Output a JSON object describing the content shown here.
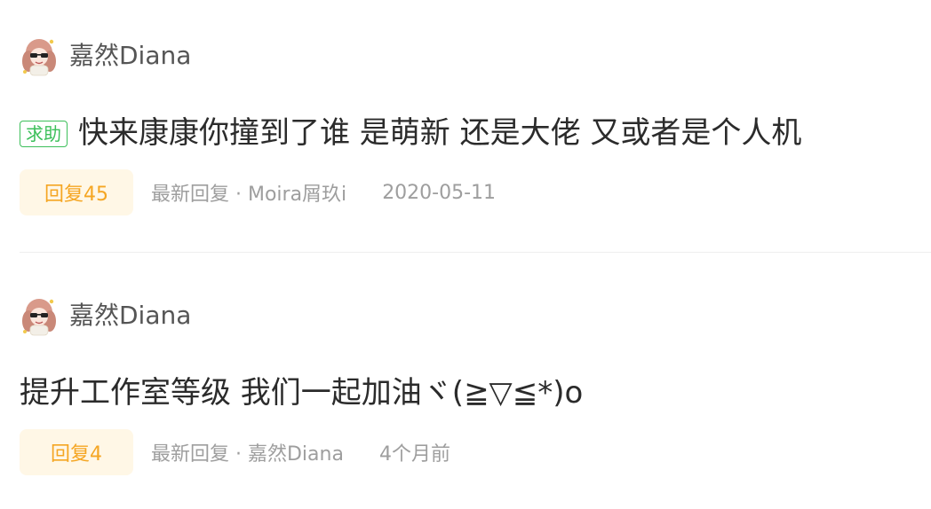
{
  "posts": [
    {
      "author": "嘉然Diana",
      "tag": "求助",
      "title": "快来康康你撞到了谁 是萌新 还是大佬 又或者是个人机",
      "reply": "回复45",
      "latest": "最新回复 · Moira屑玖i",
      "time": "2020-05-11"
    },
    {
      "author": "嘉然Diana",
      "title": "提升工作室等级 我们一起加油ヾ(≧▽≦*)o",
      "reply": "回复4",
      "latest": "最新回复 · 嘉然Diana",
      "time": "4个月前"
    }
  ],
  "icons": {
    "avatar": "avatar-icon"
  },
  "colors": {
    "tag_green": "#3cbf5a",
    "reply_orange": "#f5a623",
    "reply_bg": "#fff7e6",
    "meta_gray": "#9e9e9e"
  }
}
